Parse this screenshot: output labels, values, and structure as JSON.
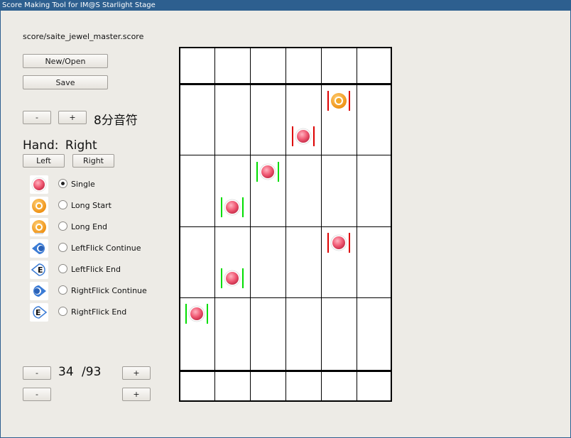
{
  "window": {
    "title": "Score Making Tool for IM@S Starlight Stage"
  },
  "file": {
    "path": "score/saite_jewel_master.score"
  },
  "buttons": {
    "new_open": "New/Open",
    "save": "Save",
    "minus": "-",
    "plus": "+",
    "left": "Left",
    "right": "Right"
  },
  "note_division": {
    "label": "8分音符"
  },
  "hand": {
    "label": "Hand:",
    "value": "Right"
  },
  "note_types": [
    {
      "label": "Single",
      "icon": "single-note-icon",
      "selected": true
    },
    {
      "label": "Long Start",
      "icon": "long-start-note-icon",
      "selected": false
    },
    {
      "label": "Long End",
      "icon": "long-end-note-icon",
      "selected": false
    },
    {
      "label": "LeftFlick Continue",
      "icon": "left-flick-continue-icon",
      "selected": false
    },
    {
      "label": "LeftFlick End",
      "icon": "left-flick-end-icon",
      "selected": false
    },
    {
      "label": "RightFlick Continue",
      "icon": "right-flick-continue-icon",
      "selected": false
    },
    {
      "label": "RightFlick End",
      "icon": "right-flick-end-icon",
      "selected": false
    }
  ],
  "measure": {
    "current": "34",
    "total": "/93"
  },
  "score_grid": {
    "lanes": 6,
    "notes": [
      {
        "lane": 5,
        "row": 1,
        "type": "long",
        "hand": "right"
      },
      {
        "lane": 4,
        "row": 2,
        "type": "single",
        "hand": "right"
      },
      {
        "lane": 3,
        "row": 3,
        "type": "single",
        "hand": "left"
      },
      {
        "lane": 2,
        "row": 4,
        "type": "single",
        "hand": "left"
      },
      {
        "lane": 5,
        "row": 5,
        "type": "single",
        "hand": "right"
      },
      {
        "lane": 2,
        "row": 6,
        "type": "single",
        "hand": "left"
      },
      {
        "lane": 1,
        "row": 7,
        "type": "single",
        "hand": "left"
      }
    ]
  },
  "colors": {
    "single_note": "#e8455f",
    "long_note": "#f3a020",
    "flick_note": "#3a7bd5",
    "left_hand_marker": "#00dd00",
    "right_hand_marker": "#dd0000",
    "title_bar": "#2d5f8f"
  }
}
